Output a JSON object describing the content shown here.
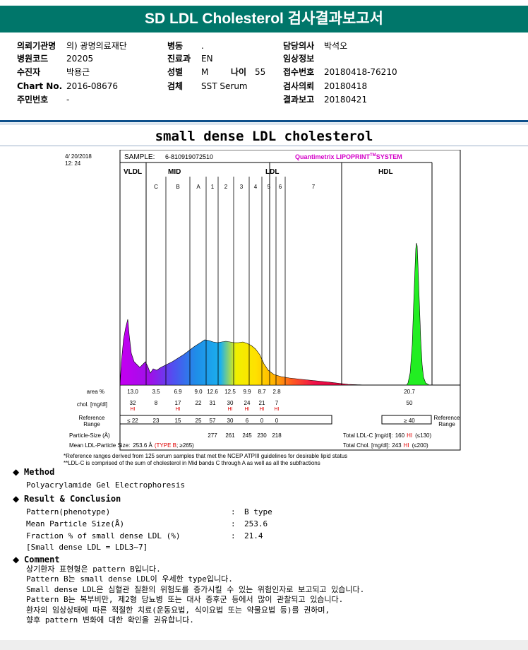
{
  "header": {
    "title": "SD LDL Cholesterol 검사결과보고서"
  },
  "info": {
    "col1": [
      {
        "k": "의뢰기관명",
        "v": "의) 광명의료재단"
      },
      {
        "k": "병원코드",
        "v": "20205"
      },
      {
        "k": "수진자",
        "v": "박용근"
      },
      {
        "k": "Chart No.",
        "v": "2016-08676"
      },
      {
        "k": "주민번호",
        "v": "-"
      }
    ],
    "col2": [
      {
        "k": "병동",
        "v": "."
      },
      {
        "k": "진료과",
        "v": "EN"
      },
      {
        "k": "성별",
        "v": "M"
      },
      {
        "k": "검체",
        "v": "SST Serum"
      }
    ],
    "age": {
      "k": "나이",
      "v": "55"
    },
    "col3": [
      {
        "k": "담당의사",
        "v": "박석오"
      },
      {
        "k": "임상정보",
        "v": ""
      },
      {
        "k": "접수번호",
        "v": "20180418-76210"
      },
      {
        "k": "검사의뢰",
        "v": "20180418"
      },
      {
        "k": "결과보고",
        "v": "20180421"
      }
    ]
  },
  "chart_title": "small dense LDL cholesterol",
  "chart_data": {
    "type": "area",
    "date": "4/ 20/2018",
    "time": "12: 24",
    "sample_label": "SAMPLE:",
    "sample_id": "6-810919072510",
    "system": "Quantimetrix LIPOPRINT",
    "system_tm": "TM",
    "system_suffix": "SYSTEM",
    "groups": [
      "VLDL",
      "MID",
      "LDL",
      "HDL"
    ],
    "mid_bands": [
      "C",
      "B",
      "A"
    ],
    "ldl_bands": [
      "1",
      "2",
      "3",
      "4",
      "5",
      "6",
      "7"
    ],
    "row_labels": {
      "area": "area %",
      "chol": "chol. [mg/dl]",
      "ref1": "Reference",
      "ref2": "Range",
      "particle": "Particle-Size (Å)",
      "mean": "Mean LDL-Particle Size:"
    },
    "area": [
      "13.0",
      "3.5",
      "6.9",
      "9.0",
      "12.6",
      "12.5",
      "9.9",
      "8.7",
      "2.8"
    ],
    "area_hdl": "20.7",
    "chol": [
      "32",
      "8",
      "17",
      "22",
      "31",
      "30",
      "24",
      "21",
      "7"
    ],
    "chol_hi": [
      true,
      false,
      true,
      false,
      false,
      true,
      true,
      true,
      true
    ],
    "chol_hdl": "50",
    "hi": "HI",
    "reference": [
      "≤ 22",
      "23",
      "15",
      "25",
      "57",
      "30",
      "6",
      "0",
      "0"
    ],
    "reference_hdl": "≥ 40",
    "particle_sizes": [
      "277",
      "261",
      "245",
      "230",
      "218"
    ],
    "mean_size": "253.6 Å",
    "type_label": "TYPE B",
    "mean_ref": "≥265",
    "total_ldl_label": "Total LDL-C [mg/dl]:",
    "total_ldl": "160",
    "total_ldl_ref": "≤130",
    "total_chol_label": "Total Chol. [mg/dl]:",
    "total_chol": "243",
    "total_chol_ref": "≤200"
  },
  "notes": [
    "*Reference ranges derived from 125 serum samples that met the NCEP ATPIII guidelines for desirable lipid status",
    "**LDL-C is comprised of the sum of cholesterol in Mid bands C through A as well as all the subfractions"
  ],
  "method": {
    "title": "Method",
    "text": "Polyacrylamide Gel Electrophoresis"
  },
  "result": {
    "title": "Result & Conclusion",
    "rows": [
      {
        "k": "Pattern(phenotype)",
        "v": "B type"
      },
      {
        "k": "Mean Particle Size(Å)",
        "v": "253.6"
      },
      {
        "k": "Fraction % of small dense LDL (%)",
        "v": "21.4"
      }
    ],
    "note": "[Small dense LDL = LDL3~7]"
  },
  "comment": {
    "title": "Comment",
    "lines": [
      "상기환자 표현형은 pattern B입니다.",
      "Pattern B는 small dense LDL이 우세한 type입니다.",
      "Small dense LDL은 심혈관 질환의 위험도를 증가시킬 수 있는 위험인자로 보고되고 있습니다.",
      "Pattern B는 복부비만, 제2형 당뇨병 또는 대사 증후군 등에서 많이 관찰되고 있습니다.",
      "환자의 임상상태에 따른 적절한 치료(운동요법, 식이요법 또는 약물요법 등)를 권하며,",
      "향후 pattern 변화에 대한 확인을 권유합니다."
    ]
  }
}
